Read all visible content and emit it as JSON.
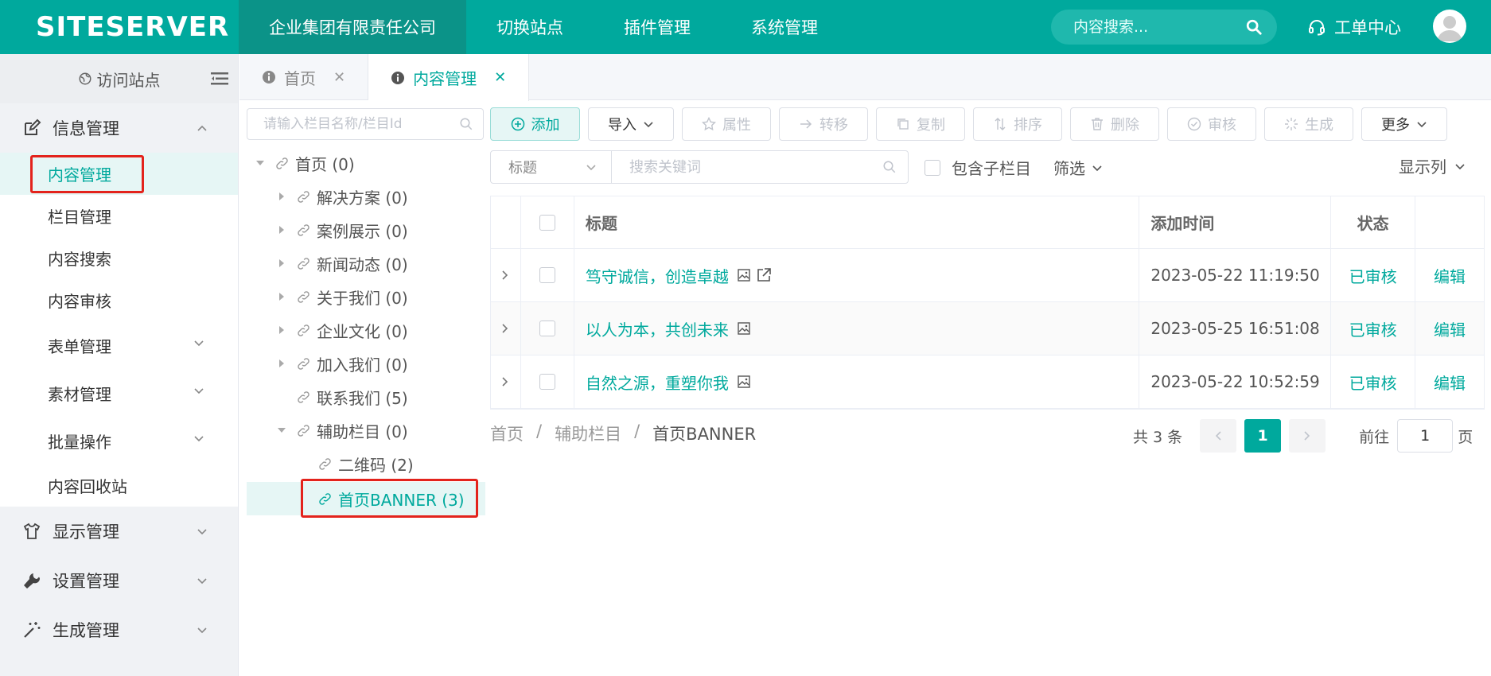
{
  "header": {
    "logo": "SITESERVER",
    "nav": [
      {
        "label": "企业集团有限责任公司",
        "active": true
      },
      {
        "label": "切换站点",
        "active": false
      },
      {
        "label": "插件管理",
        "active": false
      },
      {
        "label": "系统管理",
        "active": false
      }
    ],
    "search_placeholder": "内容搜索...",
    "ticket_label": "工单中心"
  },
  "sidebar": {
    "visit_label": "访问站点",
    "groups": [
      {
        "label": "信息管理",
        "icon": "edit-icon",
        "expanded": true,
        "items": [
          {
            "label": "内容管理",
            "active": true
          },
          {
            "label": "栏目管理"
          },
          {
            "label": "内容搜索"
          },
          {
            "label": "内容审核"
          },
          {
            "label": "表单管理",
            "expandable": true
          },
          {
            "label": "素材管理",
            "expandable": true
          },
          {
            "label": "批量操作",
            "expandable": true
          },
          {
            "label": "内容回收站"
          }
        ]
      },
      {
        "label": "显示管理",
        "icon": "shirt-icon"
      },
      {
        "label": "设置管理",
        "icon": "wrench-icon"
      },
      {
        "label": "生成管理",
        "icon": "magic-wand-icon"
      }
    ]
  },
  "tabs": [
    {
      "label": "首页",
      "active": false
    },
    {
      "label": "内容管理",
      "active": true
    }
  ],
  "tree": {
    "search_placeholder": "请输入栏目名称/栏目Id",
    "nodes": [
      {
        "label": "首页 (0)",
        "level": 0,
        "caret": "down"
      },
      {
        "label": "解决方案 (0)",
        "level": 1,
        "caret": "right"
      },
      {
        "label": "案例展示 (0)",
        "level": 1,
        "caret": "right"
      },
      {
        "label": "新闻动态 (0)",
        "level": 1,
        "caret": "right"
      },
      {
        "label": "关于我们 (0)",
        "level": 1,
        "caret": "right"
      },
      {
        "label": "企业文化 (0)",
        "level": 1,
        "caret": "right"
      },
      {
        "label": "加入我们 (0)",
        "level": 1,
        "caret": "right"
      },
      {
        "label": "联系我们 (5)",
        "level": 1,
        "caret": "none"
      },
      {
        "label": "辅助栏目 (0)",
        "level": 1,
        "caret": "down"
      },
      {
        "label": "二维码 (2)",
        "level": 2,
        "caret": "none"
      },
      {
        "label": "首页BANNER (3)",
        "level": 2,
        "caret": "none",
        "selected": true
      }
    ]
  },
  "toolbar": {
    "add": "添加",
    "import": "导入",
    "attr": "属性",
    "move": "转移",
    "copy": "复制",
    "sort": "排序",
    "delete": "删除",
    "audit": "审核",
    "generate": "生成",
    "more": "更多"
  },
  "filter": {
    "field": "标题",
    "keyword_placeholder": "搜索关键词",
    "include_children": "包含子栏目",
    "screen": "筛选",
    "show_columns": "显示列"
  },
  "table": {
    "headers": {
      "title": "标题",
      "time": "添加时间",
      "status": "状态"
    },
    "rows": [
      {
        "title": "笃守诚信，创造卓越",
        "time": "2023-05-22 11:19:50",
        "status": "已审核",
        "action": "编辑",
        "external": true
      },
      {
        "title": "以人为本，共创未来",
        "time": "2023-05-25 16:51:08",
        "status": "已审核",
        "action": "编辑",
        "external": false
      },
      {
        "title": "自然之源，重塑你我",
        "time": "2023-05-22 10:52:59",
        "status": "已审核",
        "action": "编辑",
        "external": false
      }
    ]
  },
  "breadcrumb": [
    "首页",
    "辅助栏目",
    "首页BANNER"
  ],
  "breadcrumb_sep": "/",
  "pagination": {
    "total": "共 3 条",
    "current": "1",
    "goto_label": "前往",
    "goto_value": "1",
    "page_suffix": "页"
  },
  "colors": {
    "brand": "#00a99d",
    "highlight": "#e3231c"
  }
}
